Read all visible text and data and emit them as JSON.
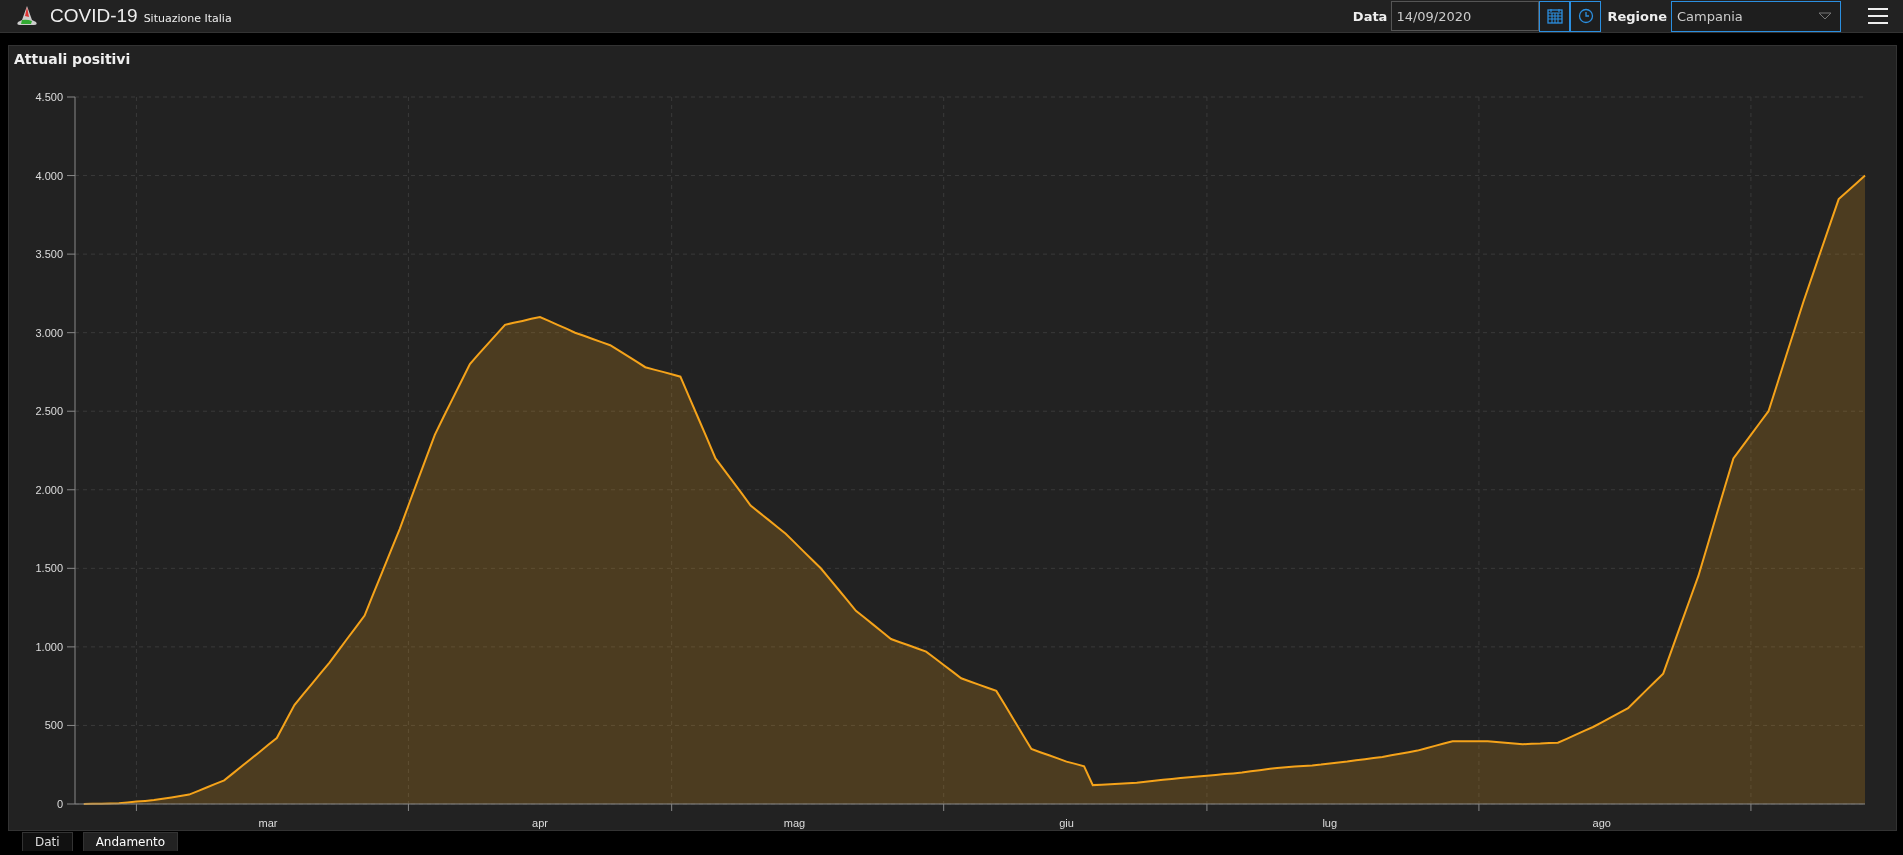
{
  "header": {
    "title": "COVID-19",
    "subtitle": "Situazione Italia",
    "date_label": "Data",
    "date_value": "14/09/2020",
    "region_label": "Regione",
    "region_value": "Campania"
  },
  "panel": {
    "title": "Attuali positivi",
    "chart_data": {
      "type": "area",
      "categories": [
        null,
        null,
        null,
        null,
        null,
        null,
        null,
        null,
        null,
        null,
        null,
        null,
        null,
        null,
        null,
        null,
        null,
        null,
        null,
        null,
        null,
        "mar",
        null,
        null,
        null,
        null,
        null,
        null,
        null,
        null,
        null,
        null,
        null,
        null,
        null,
        null,
        null,
        null,
        null,
        null,
        null,
        null,
        null,
        null,
        null,
        null,
        null,
        null,
        null,
        null,
        null,
        null,
        "apr",
        null,
        null,
        null,
        null,
        null,
        null,
        null,
        null,
        null,
        null,
        null,
        null,
        null,
        null,
        null,
        null,
        null,
        null,
        null,
        null,
        null,
        null,
        null,
        null,
        null,
        null,
        null,
        null,
        "mag",
        null,
        null,
        null,
        null,
        null,
        null,
        null,
        null,
        null,
        null,
        null,
        null,
        null,
        null,
        null,
        null,
        null,
        null,
        null,
        null,
        null,
        null,
        null,
        null,
        null,
        null,
        null,
        null,
        null,
        null,
        "giu",
        null,
        null,
        null,
        null,
        null,
        null,
        null,
        null,
        null,
        null,
        null,
        null,
        null,
        null,
        null,
        null,
        null,
        null,
        null,
        null,
        null,
        null,
        null,
        null,
        null,
        null,
        null,
        null,
        null,
        "lug",
        null,
        null,
        null,
        null,
        null,
        null,
        null,
        null,
        null,
        null,
        null,
        null,
        null,
        null,
        null,
        null,
        null,
        null,
        null,
        null,
        null,
        null,
        null,
        null,
        null,
        null,
        null,
        null,
        null,
        null,
        "ago",
        null,
        null,
        null,
        null,
        null,
        null,
        null,
        null,
        null,
        null,
        null,
        null,
        null,
        null,
        null,
        null,
        null,
        null,
        null,
        null,
        null,
        null,
        null,
        null,
        null,
        null,
        null,
        null,
        null,
        null
      ],
      "series": [
        {
          "color": "#f5a31a",
          "values": [
            0,
            1,
            2,
            4,
            5,
            10,
            15,
            20,
            25,
            34,
            42,
            51,
            60,
            82,
            105,
            128,
            150,
            195,
            240,
            285,
            330,
            375,
            420,
            525,
            630,
            698,
            765,
            833,
            900,
            975,
            1050,
            1125,
            1200,
            1338,
            1475,
            1613,
            1750,
            1900,
            2050,
            2200,
            2350,
            2463,
            2575,
            2688,
            2800,
            2863,
            2925,
            2988,
            3050,
            3063,
            3075,
            3088,
            3100,
            3075,
            3050,
            3025,
            3000,
            2980,
            2960,
            2940,
            2920,
            2885,
            2850,
            2815,
            2780,
            2765,
            2750,
            2735,
            2720,
            2590,
            2460,
            2330,
            2200,
            2125,
            2050,
            1975,
            1900,
            1855,
            1810,
            1765,
            1720,
            1665,
            1610,
            1555,
            1500,
            1433,
            1365,
            1298,
            1230,
            1185,
            1140,
            1095,
            1050,
            1030,
            1010,
            990,
            970,
            928,
            885,
            843,
            800,
            780,
            760,
            740,
            720,
            628,
            535,
            443,
            350,
            330,
            310,
            290,
            270,
            255,
            240,
            120,
            123,
            126,
            129,
            132,
            135,
            141,
            148,
            154,
            160,
            165,
            170,
            175,
            180,
            185,
            190,
            195,
            200,
            208,
            215,
            223,
            230,
            234,
            238,
            241,
            245,
            251,
            258,
            264,
            270,
            278,
            285,
            293,
            300,
            310,
            320,
            330,
            340,
            355,
            370,
            385,
            400,
            400,
            400,
            400,
            400,
            395,
            390,
            385,
            380,
            383,
            385,
            388,
            390,
            415,
            440,
            465,
            490,
            520,
            550,
            580,
            610,
            665,
            720,
            775,
            830,
            985,
            1140,
            1295,
            1450,
            1638,
            1825,
            2013,
            2200,
            2275,
            2350,
            2425,
            2500,
            2675,
            2850,
            3025,
            3200,
            3363,
            3525,
            3688,
            3850,
            3900,
            3950,
            4000
          ]
        }
      ],
      "grid": true,
      "ylim": [
        0,
        4500
      ],
      "yticks": [
        {
          "value": 0,
          "label": "0"
        },
        {
          "value": 500,
          "label": "500"
        },
        {
          "value": 1000,
          "label": "1.000"
        },
        {
          "value": 1500,
          "label": "1.500"
        },
        {
          "value": 2000,
          "label": "2.000"
        },
        {
          "value": 2500,
          "label": "2.500"
        },
        {
          "value": 3000,
          "label": "3.000"
        },
        {
          "value": 3500,
          "label": "3.500"
        },
        {
          "value": 4000,
          "label": "4.000"
        },
        {
          "value": 4500,
          "label": "4.500"
        }
      ]
    }
  },
  "tabs": [
    {
      "label": "Dati",
      "selected": false
    },
    {
      "label": "Andamento",
      "selected": true
    }
  ]
}
